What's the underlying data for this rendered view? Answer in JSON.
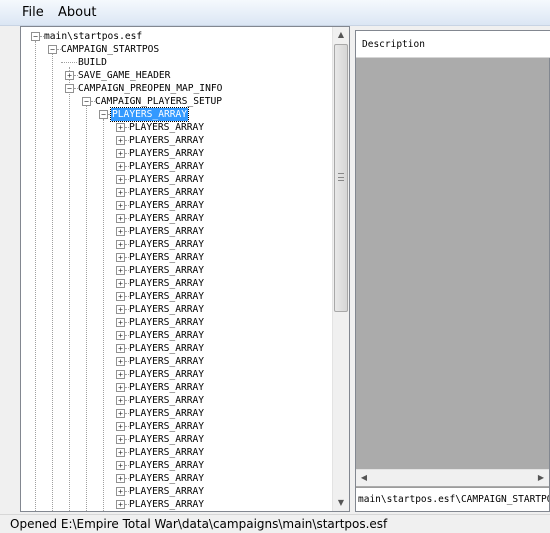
{
  "menu": {
    "items": [
      {
        "label": "File"
      },
      {
        "label": "About"
      }
    ]
  },
  "tree": {
    "nodes": [
      {
        "label": "main\\startpos.esf",
        "level": 0,
        "expander": "minus"
      },
      {
        "label": "CAMPAIGN_STARTPOS",
        "level": 1,
        "expander": "minus"
      },
      {
        "label": "BUILD",
        "level": 2,
        "expander": "none"
      },
      {
        "label": "SAVE_GAME_HEADER",
        "level": 2,
        "expander": "plus"
      },
      {
        "label": "CAMPAIGN_PREOPEN_MAP_INFO",
        "level": 2,
        "expander": "minus"
      },
      {
        "label": "CAMPAIGN_PLAYERS_SETUP",
        "level": 3,
        "expander": "minus"
      },
      {
        "label": "PLAYERS_ARRAY",
        "level": 4,
        "expander": "minus",
        "selected": true
      },
      {
        "label": "PLAYERS_ARRAY",
        "level": 5,
        "expander": "plus"
      },
      {
        "label": "PLAYERS_ARRAY",
        "level": 5,
        "expander": "plus"
      },
      {
        "label": "PLAYERS_ARRAY",
        "level": 5,
        "expander": "plus"
      },
      {
        "label": "PLAYERS_ARRAY",
        "level": 5,
        "expander": "plus"
      },
      {
        "label": "PLAYERS_ARRAY",
        "level": 5,
        "expander": "plus"
      },
      {
        "label": "PLAYERS_ARRAY",
        "level": 5,
        "expander": "plus"
      },
      {
        "label": "PLAYERS_ARRAY",
        "level": 5,
        "expander": "plus"
      },
      {
        "label": "PLAYERS_ARRAY",
        "level": 5,
        "expander": "plus"
      },
      {
        "label": "PLAYERS_ARRAY",
        "level": 5,
        "expander": "plus"
      },
      {
        "label": "PLAYERS_ARRAY",
        "level": 5,
        "expander": "plus"
      },
      {
        "label": "PLAYERS_ARRAY",
        "level": 5,
        "expander": "plus"
      },
      {
        "label": "PLAYERS_ARRAY",
        "level": 5,
        "expander": "plus"
      },
      {
        "label": "PLAYERS_ARRAY",
        "level": 5,
        "expander": "plus"
      },
      {
        "label": "PLAYERS_ARRAY",
        "level": 5,
        "expander": "plus"
      },
      {
        "label": "PLAYERS_ARRAY",
        "level": 5,
        "expander": "plus"
      },
      {
        "label": "PLAYERS_ARRAY",
        "level": 5,
        "expander": "plus"
      },
      {
        "label": "PLAYERS_ARRAY",
        "level": 5,
        "expander": "plus"
      },
      {
        "label": "PLAYERS_ARRAY",
        "level": 5,
        "expander": "plus"
      },
      {
        "label": "PLAYERS_ARRAY",
        "level": 5,
        "expander": "plus"
      },
      {
        "label": "PLAYERS_ARRAY",
        "level": 5,
        "expander": "plus"
      },
      {
        "label": "PLAYERS_ARRAY",
        "level": 5,
        "expander": "plus"
      },
      {
        "label": "PLAYERS_ARRAY",
        "level": 5,
        "expander": "plus"
      },
      {
        "label": "PLAYERS_ARRAY",
        "level": 5,
        "expander": "plus"
      },
      {
        "label": "PLAYERS_ARRAY",
        "level": 5,
        "expander": "plus"
      },
      {
        "label": "PLAYERS_ARRAY",
        "level": 5,
        "expander": "plus"
      },
      {
        "label": "PLAYERS_ARRAY",
        "level": 5,
        "expander": "plus"
      },
      {
        "label": "PLAYERS_ARRAY",
        "level": 5,
        "expander": "plus"
      },
      {
        "label": "PLAYERS_ARRAY",
        "level": 5,
        "expander": "plus"
      },
      {
        "label": "PLAYERS_ARRAY",
        "level": 5,
        "expander": "plus"
      },
      {
        "label": "PLAYERS_ARRAY",
        "level": 5,
        "expander": "plus"
      },
      {
        "label": "PLAYERS_ARRAY",
        "level": 5,
        "expander": "plus"
      }
    ],
    "scroll_position": 0
  },
  "details": {
    "column_header": "Description",
    "path_text": "main\\startpos.esf\\CAMPAIGN_STARTPOS"
  },
  "status": {
    "text": "Opened E:\\Empire Total War\\data\\campaigns\\main\\startpos.esf"
  },
  "icons": {
    "scroll_up": "scroll-up-arrow-icon",
    "scroll_down": "scroll-down-arrow-icon",
    "scroll_left": "scroll-left-arrow-icon",
    "scroll_right": "scroll-right-arrow-icon"
  }
}
